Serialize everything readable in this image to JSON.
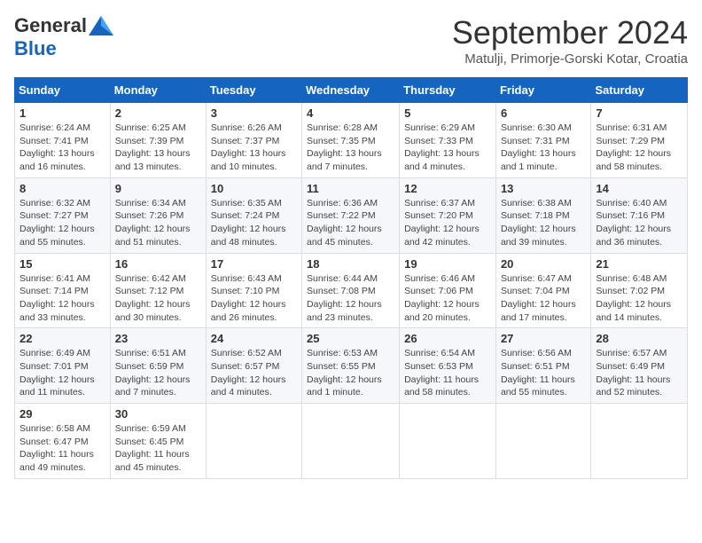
{
  "header": {
    "logo_general": "General",
    "logo_blue": "Blue",
    "month_title": "September 2024",
    "location": "Matulji, Primorje-Gorski Kotar, Croatia"
  },
  "weekdays": [
    "Sunday",
    "Monday",
    "Tuesday",
    "Wednesday",
    "Thursday",
    "Friday",
    "Saturday"
  ],
  "weeks": [
    [
      {
        "day": "1",
        "info": "Sunrise: 6:24 AM\nSunset: 7:41 PM\nDaylight: 13 hours\nand 16 minutes."
      },
      {
        "day": "2",
        "info": "Sunrise: 6:25 AM\nSunset: 7:39 PM\nDaylight: 13 hours\nand 13 minutes."
      },
      {
        "day": "3",
        "info": "Sunrise: 6:26 AM\nSunset: 7:37 PM\nDaylight: 13 hours\nand 10 minutes."
      },
      {
        "day": "4",
        "info": "Sunrise: 6:28 AM\nSunset: 7:35 PM\nDaylight: 13 hours\nand 7 minutes."
      },
      {
        "day": "5",
        "info": "Sunrise: 6:29 AM\nSunset: 7:33 PM\nDaylight: 13 hours\nand 4 minutes."
      },
      {
        "day": "6",
        "info": "Sunrise: 6:30 AM\nSunset: 7:31 PM\nDaylight: 13 hours\nand 1 minute."
      },
      {
        "day": "7",
        "info": "Sunrise: 6:31 AM\nSunset: 7:29 PM\nDaylight: 12 hours\nand 58 minutes."
      }
    ],
    [
      {
        "day": "8",
        "info": "Sunrise: 6:32 AM\nSunset: 7:27 PM\nDaylight: 12 hours\nand 55 minutes."
      },
      {
        "day": "9",
        "info": "Sunrise: 6:34 AM\nSunset: 7:26 PM\nDaylight: 12 hours\nand 51 minutes."
      },
      {
        "day": "10",
        "info": "Sunrise: 6:35 AM\nSunset: 7:24 PM\nDaylight: 12 hours\nand 48 minutes."
      },
      {
        "day": "11",
        "info": "Sunrise: 6:36 AM\nSunset: 7:22 PM\nDaylight: 12 hours\nand 45 minutes."
      },
      {
        "day": "12",
        "info": "Sunrise: 6:37 AM\nSunset: 7:20 PM\nDaylight: 12 hours\nand 42 minutes."
      },
      {
        "day": "13",
        "info": "Sunrise: 6:38 AM\nSunset: 7:18 PM\nDaylight: 12 hours\nand 39 minutes."
      },
      {
        "day": "14",
        "info": "Sunrise: 6:40 AM\nSunset: 7:16 PM\nDaylight: 12 hours\nand 36 minutes."
      }
    ],
    [
      {
        "day": "15",
        "info": "Sunrise: 6:41 AM\nSunset: 7:14 PM\nDaylight: 12 hours\nand 33 minutes."
      },
      {
        "day": "16",
        "info": "Sunrise: 6:42 AM\nSunset: 7:12 PM\nDaylight: 12 hours\nand 30 minutes."
      },
      {
        "day": "17",
        "info": "Sunrise: 6:43 AM\nSunset: 7:10 PM\nDaylight: 12 hours\nand 26 minutes."
      },
      {
        "day": "18",
        "info": "Sunrise: 6:44 AM\nSunset: 7:08 PM\nDaylight: 12 hours\nand 23 minutes."
      },
      {
        "day": "19",
        "info": "Sunrise: 6:46 AM\nSunset: 7:06 PM\nDaylight: 12 hours\nand 20 minutes."
      },
      {
        "day": "20",
        "info": "Sunrise: 6:47 AM\nSunset: 7:04 PM\nDaylight: 12 hours\nand 17 minutes."
      },
      {
        "day": "21",
        "info": "Sunrise: 6:48 AM\nSunset: 7:02 PM\nDaylight: 12 hours\nand 14 minutes."
      }
    ],
    [
      {
        "day": "22",
        "info": "Sunrise: 6:49 AM\nSunset: 7:01 PM\nDaylight: 12 hours\nand 11 minutes."
      },
      {
        "day": "23",
        "info": "Sunrise: 6:51 AM\nSunset: 6:59 PM\nDaylight: 12 hours\nand 7 minutes."
      },
      {
        "day": "24",
        "info": "Sunrise: 6:52 AM\nSunset: 6:57 PM\nDaylight: 12 hours\nand 4 minutes."
      },
      {
        "day": "25",
        "info": "Sunrise: 6:53 AM\nSunset: 6:55 PM\nDaylight: 12 hours\nand 1 minute."
      },
      {
        "day": "26",
        "info": "Sunrise: 6:54 AM\nSunset: 6:53 PM\nDaylight: 11 hours\nand 58 minutes."
      },
      {
        "day": "27",
        "info": "Sunrise: 6:56 AM\nSunset: 6:51 PM\nDaylight: 11 hours\nand 55 minutes."
      },
      {
        "day": "28",
        "info": "Sunrise: 6:57 AM\nSunset: 6:49 PM\nDaylight: 11 hours\nand 52 minutes."
      }
    ],
    [
      {
        "day": "29",
        "info": "Sunrise: 6:58 AM\nSunset: 6:47 PM\nDaylight: 11 hours\nand 49 minutes."
      },
      {
        "day": "30",
        "info": "Sunrise: 6:59 AM\nSunset: 6:45 PM\nDaylight: 11 hours\nand 45 minutes."
      },
      null,
      null,
      null,
      null,
      null
    ]
  ]
}
